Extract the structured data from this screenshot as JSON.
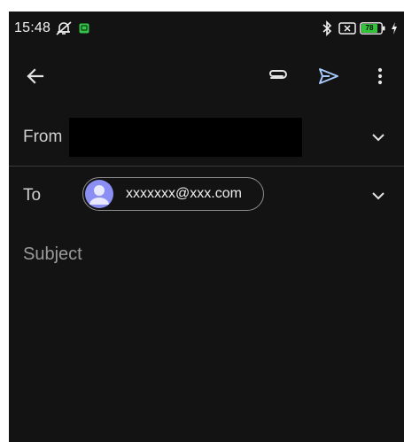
{
  "status_bar": {
    "time": "15:48",
    "battery_level": "78",
    "icons": [
      "mute-icon",
      "app-notification-icon",
      "bluetooth-icon",
      "no-sim-icon",
      "battery-icon",
      "charging-icon"
    ]
  },
  "toolbar": {
    "icons": [
      "back-arrow-icon",
      "attach-icon",
      "send-icon",
      "more-vert-icon"
    ],
    "send_color": "#a8c7fa"
  },
  "compose": {
    "from_label": "From",
    "to_label": "To",
    "recipient_email": "xxxxxxx@xxx.com",
    "subject_placeholder": "Subject"
  },
  "colors": {
    "background": "#131313",
    "avatar": "#8b8ef2",
    "text": "#e3e3e3"
  }
}
